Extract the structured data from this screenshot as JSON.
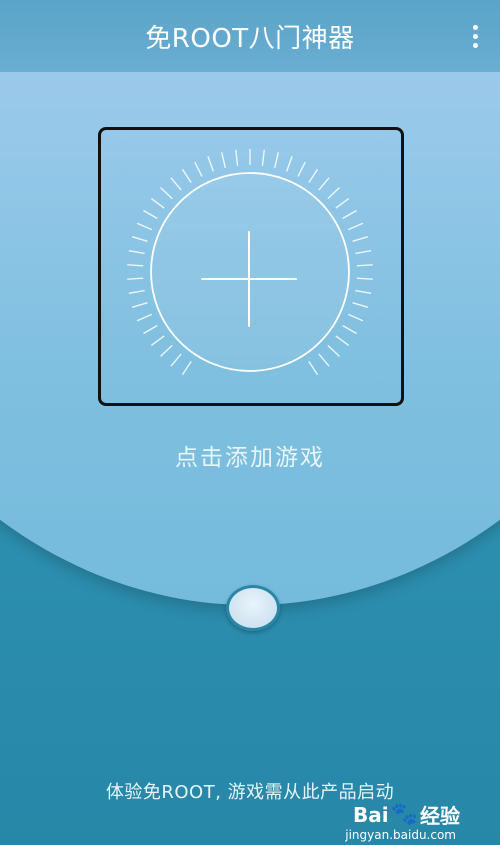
{
  "app": {
    "title": "免ROOT八门神器"
  },
  "main": {
    "add_game_label": "点击添加游戏",
    "footer_text": "体验免ROOT, 游戏需从此产品启动"
  },
  "watermark": {
    "brand_left": "Bai",
    "brand_right": "经验",
    "url": "jingyan.baidu.com"
  },
  "icons": {
    "menu": "more-vert-icon",
    "add": "plus-icon",
    "paw": "baidu-paw-icon"
  },
  "colors": {
    "topbar": "#5aa3c8",
    "dome": "#a3cbee",
    "background": "#2e8fb0",
    "text_light": "#eaf4fb"
  }
}
